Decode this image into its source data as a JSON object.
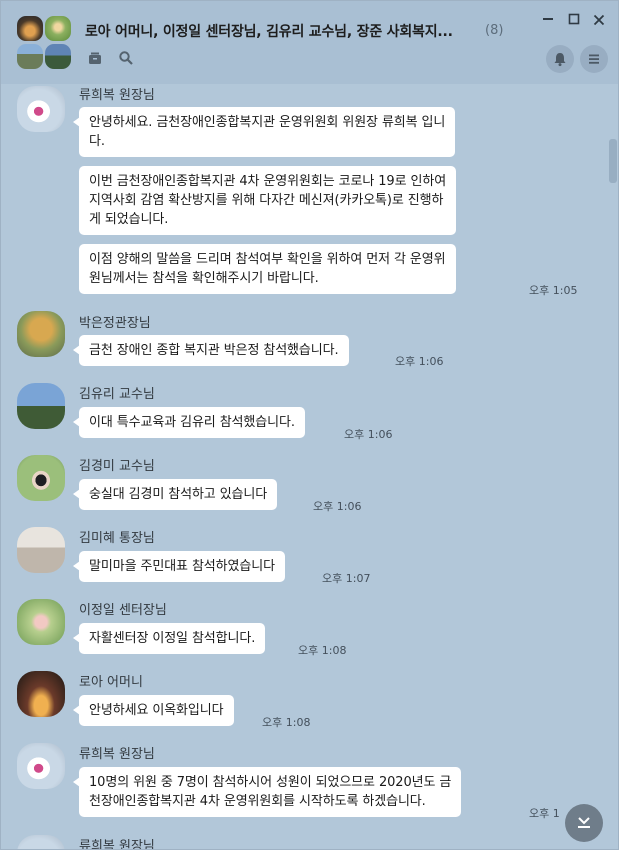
{
  "header": {
    "title": "로아 어머니, 이정일 센터장님, 김유리 교수님, 장준 사회복지...",
    "member_count": "(8)"
  },
  "icons": {
    "minimize": "minimize-icon",
    "maximize": "maximize-icon",
    "close": "close-icon",
    "drawer": "drawer-icon",
    "search": "search-icon",
    "bell": "bell-icon",
    "menu": "menu-icon",
    "scroll_down": "scroll-down-icon"
  },
  "messages": [
    {
      "sender": "류희복 원장님",
      "text": [
        "안녕하세요. 금천장애인종합복지관 운영위원회 위원장 류희복 입니",
        "다."
      ]
    },
    {
      "text": [
        "이번 금천장애인종합복지관 4차 운영위원회는 코로나 19로 인하여",
        "지역사회 감염 확산방지를 위해 다자간 메신져(카카오톡)로 진행하",
        "게 되었습니다."
      ]
    },
    {
      "text": [
        "이점 양해의 말씀을 드리며 참석여부 확인을 위하여 먼저 각 운영위",
        "원님께서는 참석을 확인해주시기 바랍니다."
      ],
      "time": "오후 1:05"
    },
    {
      "sender": "박은정관장님",
      "text": [
        "금천 장애인 종합 복지관 박은정 참석했습니다."
      ],
      "time": "오후 1:06"
    },
    {
      "sender": "김유리 교수님",
      "text": [
        "이대 특수교육과 김유리 참석했습니다."
      ],
      "time": "오후 1:06"
    },
    {
      "sender": "김경미 교수님",
      "text": [
        "숭실대 김경미 참석하고 있습니다"
      ],
      "time": "오후 1:06"
    },
    {
      "sender": "김미혜 통장님",
      "text": [
        "말미마을 주민대표 참석하였습니다"
      ],
      "time": "오후 1:07"
    },
    {
      "sender": "이정일 센터장님",
      "text": [
        "자활센터장 이정일 참석합니다."
      ],
      "time": "오후 1:08"
    },
    {
      "sender": "로아 어머니",
      "text": [
        "안녕하세요 이옥화입니다"
      ],
      "time": "오후 1:08"
    },
    {
      "sender": "류희복 원장님",
      "text": [
        "10명의 위원 중 7명이 참석하시어 성원이 되었으므로 2020년도 금",
        "천장애인종합복지관 4차 운영위원회를 시작하도록 하겠습니다."
      ],
      "time": "오후 1"
    },
    {
      "sender": "류희복 원장님"
    }
  ]
}
